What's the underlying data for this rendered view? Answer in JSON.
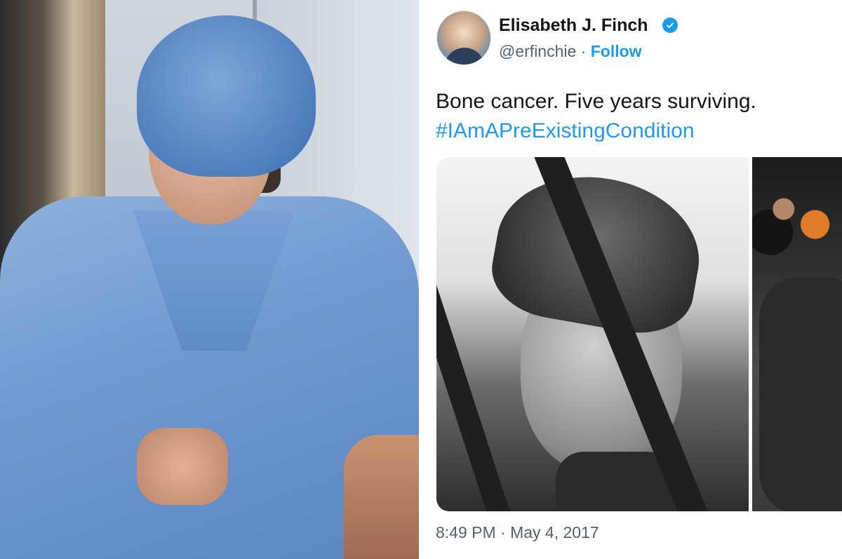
{
  "left_photo": {
    "icon": "person-in-surgical-scrubs-photo"
  },
  "tweet": {
    "author": {
      "display_name": "Elisabeth J. Finch",
      "handle": "@erfinchie",
      "separator": " · ",
      "follow_label": "Follow",
      "verified_icon": "verified-badge-icon",
      "avatar_icon": "profile-avatar"
    },
    "text_line": "Bone cancer. Five years surviving.",
    "hashtag": "#IAmAPreExistingCondition",
    "media": [
      {
        "icon": "black-and-white-selfie-photo"
      },
      {
        "icon": "group-photo"
      }
    ],
    "timestamp": "8:49 PM · May 4, 2017"
  },
  "colors": {
    "link_blue": "#1d9bf0",
    "text_dark": "#14171a",
    "text_gray": "#536471",
    "scrubs_blue": "#6f98cf"
  }
}
